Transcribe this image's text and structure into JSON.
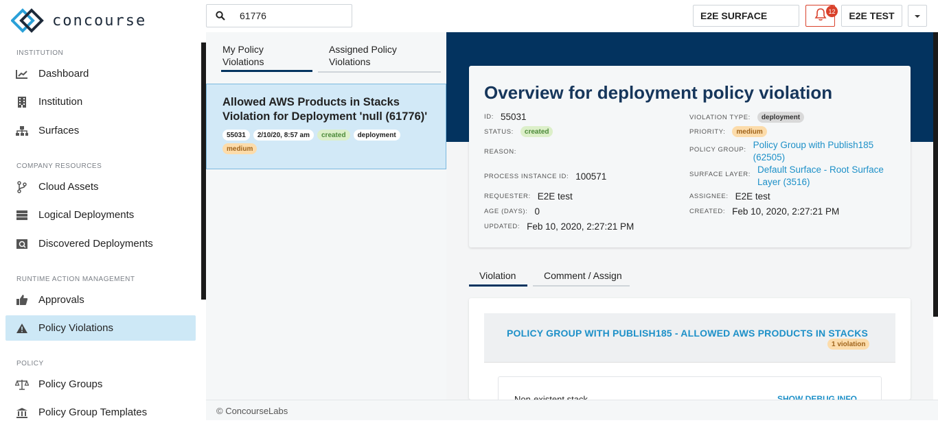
{
  "app": {
    "name": "concourse"
  },
  "sidebar": {
    "sections": [
      {
        "label": "INSTITUTION"
      },
      {
        "label": "COMPANY RESOURCES"
      },
      {
        "label": "RUNTIME ACTION MANAGEMENT"
      },
      {
        "label": "POLICY"
      }
    ],
    "items": [
      {
        "label": "Dashboard",
        "icon": "chart-line-icon"
      },
      {
        "label": "Institution",
        "icon": "building-icon"
      },
      {
        "label": "Surfaces",
        "icon": "sitemap-icon"
      },
      {
        "label": "Cloud Assets",
        "icon": "branch-icon"
      },
      {
        "label": "Logical Deployments",
        "icon": "server-icon"
      },
      {
        "label": "Discovered Deployments",
        "icon": "search-server-icon"
      },
      {
        "label": "Approvals",
        "icon": "thumbs-up-icon"
      },
      {
        "label": "Policy Violations",
        "icon": "warning-icon"
      },
      {
        "label": "Policy Groups",
        "icon": "scale-icon"
      },
      {
        "label": "Policy Group Templates",
        "icon": "bank-icon"
      }
    ]
  },
  "topbar": {
    "search_value": "61776",
    "surface": "E2E SURFACE",
    "notification_count": "12",
    "user": "E2E TEST"
  },
  "list": {
    "tabs": [
      "My Policy Violations",
      "Assigned Policy Violations"
    ],
    "tab_lines": [
      [
        "My Policy",
        "Violations"
      ],
      [
        "Assigned Policy",
        "Violations"
      ]
    ],
    "item": {
      "title_line1": "Allowed AWS Products in Stacks",
      "title_line2": "Violation for Deployment 'null (61776)'",
      "id": "55031",
      "date": "2/10/20, 8:57 am",
      "status": "created",
      "type": "deployment",
      "priority": "medium"
    }
  },
  "overview": {
    "title": "Overview for deployment policy violation",
    "labels": {
      "id": "ID:",
      "status": "STATUS:",
      "reason": "REASON:",
      "process": "PROCESS INSTANCE ID:",
      "requester": "REQUESTER:",
      "age": "AGE (DAYS):",
      "updated": "UPDATED:",
      "violation_type": "VIOLATION TYPE:",
      "priority": "PRIORITY:",
      "policy_group": "POLICY GROUP:",
      "surface_layer": "SURFACE LAYER:",
      "assignee": "ASSIGNEE:",
      "created": "CREATED:"
    },
    "values": {
      "id": "55031",
      "status": "created",
      "process": "100571",
      "requester": "E2E test",
      "age": "0",
      "updated": "Feb 10, 2020, 2:27:21 PM",
      "violation_type": "deployment",
      "priority": "medium",
      "policy_group_line1": "Policy Group with Publish185",
      "policy_group_line2": "(62505)",
      "surface_layer_line1": "Default Surface - Root Surface",
      "surface_layer_line2": "Layer (3516)",
      "assignee": "E2E test",
      "created": "Feb 10, 2020, 2:27:21 PM"
    }
  },
  "detail": {
    "tabs": [
      "Violation",
      "Comment / Assign"
    ],
    "policy_title": "POLICY GROUP WITH PUBLISH185 - ALLOWED AWS PRODUCTS IN STACKS",
    "violation_count": "1 violation",
    "stack": "Non-existent stack",
    "debug": "SHOW DEBUG INFO"
  },
  "footer": {
    "text": "© ConcourseLabs"
  },
  "colors": {
    "navy": "#03335f",
    "link": "#1d90c8",
    "active_nav": "#cde8f6",
    "alert": "#d9412b"
  }
}
